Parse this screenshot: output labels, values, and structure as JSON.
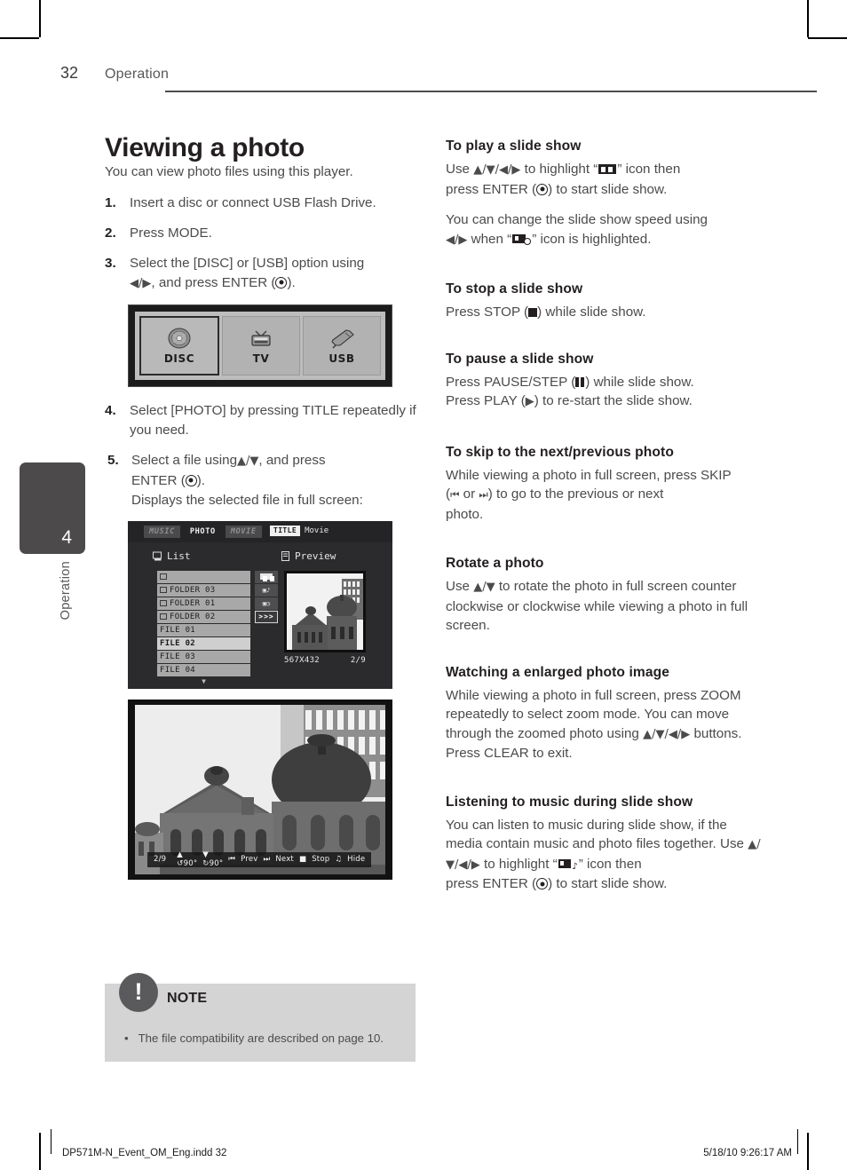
{
  "header": {
    "page_number": "32",
    "section": "Operation"
  },
  "side_tab": {
    "number": "4",
    "label": "Operation"
  },
  "left_column": {
    "title": "Viewing a photo",
    "intro": "You can view photo files using this player.",
    "steps": [
      {
        "num": "1.",
        "text": "Insert a disc or connect USB Flash Drive."
      },
      {
        "num": "2.",
        "text": "Press MODE."
      },
      {
        "num": "3.",
        "text": "Select the [DISC] or [USB] option using"
      },
      {
        "num": "4.",
        "text": "Select [PHOTO] by pressing TITLE repeatedly if you need."
      },
      {
        "num": "5.",
        "text": "Select a file using"
      }
    ],
    "step3_line2_prefix": "",
    "step3_line2_suffix": ", and press ENTER (",
    "step3_line2_end": ").",
    "step5_line1_suffix": ", and press",
    "step5_line2": "ENTER (",
    "step5_line2_end": ").",
    "step5_line3": "Displays the selected file in full screen:"
  },
  "source_screenshot": {
    "options": [
      {
        "label": "DISC",
        "icon": "disc-icon",
        "active": true
      },
      {
        "label": "TV",
        "icon": "tv-icon",
        "active": false
      },
      {
        "label": "USB",
        "icon": "usb-icon",
        "active": false
      }
    ]
  },
  "list_screenshot": {
    "tabs": [
      {
        "label": "MUSIC",
        "active": false
      },
      {
        "label": "PHOTO",
        "active": true
      },
      {
        "label": "MOVIE",
        "active": false
      }
    ],
    "title_badge": "TITLE",
    "title_text": "Movie",
    "list_header": "List",
    "preview_header": "Preview",
    "rows": [
      {
        "label": "",
        "type": "up",
        "selected": false
      },
      {
        "label": "FOLDER 03",
        "type": "folder",
        "selected": false
      },
      {
        "label": "FOLDER 01",
        "type": "folder",
        "selected": false
      },
      {
        "label": "FOLDER 02",
        "type": "folder",
        "selected": false
      },
      {
        "label": "FILE 01",
        "type": "file",
        "selected": false
      },
      {
        "label": "FILE 02",
        "type": "file",
        "selected": true
      },
      {
        "label": "FILE 03",
        "type": "file",
        "selected": false
      },
      {
        "label": "FILE 04",
        "type": "file",
        "selected": false
      }
    ],
    "scroll_indicator": "▼",
    "side_buttons": [
      {
        "name": "slideshow-icon",
        "label": "▬",
        "highlighted": false
      },
      {
        "name": "slideshow-music-icon",
        "label": "▬♪",
        "highlighted": false
      },
      {
        "name": "slideshow-speed-icon",
        "label": "▬◷",
        "highlighted": false
      },
      {
        "name": "fast-forward-icon",
        "label": ">>>",
        "highlighted": true
      }
    ],
    "resolution": "567X432",
    "index": "2/9"
  },
  "photo_screenshot": {
    "osd": {
      "index": "2/9",
      "rotate_ccw": "▲ ↺90°",
      "rotate_cw": "▼ ↻90°",
      "prev": "Prev",
      "next": "Next",
      "stop": "Stop",
      "hide": "Hide"
    }
  },
  "note": {
    "title": "NOTE",
    "bullet": "•",
    "text": "The file compatibility are described on page 10."
  },
  "right_column": {
    "sections": [
      {
        "heading": "To play a slide show",
        "paragraphs": [
          "Use ▲/▼/◀/▶ to highlight \" \" icon then press ENTER ( ) to start slide show.",
          "You can change the slide show speed using ◀/▶ when \" \" icon is highlighted."
        ]
      },
      {
        "heading": "To stop a slide show",
        "paragraphs": [
          "Press STOP ( ) while slide show."
        ]
      },
      {
        "heading": "To pause a slide show",
        "paragraphs": [
          "Press PAUSE/STEP ( ) while slide show.",
          "Press PLAY ( ) to re-start the slide show."
        ]
      },
      {
        "heading": "To skip to the next/previous photo",
        "paragraphs": [
          "While viewing a photo in full screen, press SKIP ( ◀◀ or ▶▶ ) to go to the previous or next photo."
        ]
      },
      {
        "heading": "Rotate a photo",
        "paragraphs": [
          "Use ▲/▼ to rotate the photo in full screen counter clockwise or clockwise while viewing a photo in full screen."
        ]
      },
      {
        "heading": "Watching a enlarged photo image",
        "paragraphs": [
          "While viewing a photo in full screen, press ZOOM repeatedly to select zoom mode. You can move through the zoomed photo using ▲/▼/◀/▶ buttons. Press CLEAR to exit."
        ]
      },
      {
        "heading": "Listening to music during slide show",
        "paragraphs": [
          "You can listen to music during slide show, if the media contain music and photo files together. Use ▲/▼/◀/▶ to highlight \" \" icon then press ENTER ( ) to start slide show."
        ]
      }
    ],
    "frag": {
      "play_use": "Use ",
      "play_arrows": "▲/▼/◀/▶",
      "play_hl": " to highlight “",
      "play_then": "” icon then",
      "play_press": "press ENTER (",
      "play_start": ") to start slide show.",
      "speed_1": "You can change the slide show speed using",
      "speed_arrows": "◀/▶",
      "speed_when": " when “",
      "speed_end": "” icon is highlighted.",
      "stop_1": "Press STOP (",
      "stop_2": ") while slide show.",
      "pause_1": "Press PAUSE/STEP (",
      "pause_2": ") while slide show.",
      "play2_1": "Press PLAY (",
      "play2_2": ") to re-start the slide show.",
      "skip_1": "While viewing a photo in full screen, press SKIP",
      "skip_2": "(",
      "skip_prev": "◀◀",
      "skip_or": " or ",
      "skip_next": "▶▶",
      "skip_3": ") to go to the previous or next",
      "skip_4": "photo.",
      "rotate_1": "Use ",
      "rotate_arrows": "▲/▼",
      "rotate_2": " to rotate the photo in full screen counter clockwise or clockwise while viewing a photo in full screen.",
      "zoom_1": "While viewing a photo in full screen, press ZOOM repeatedly to select zoom mode. You can move through the zoomed photo using ",
      "zoom_arrows": "▲/▼/◀/▶",
      "zoom_2": " buttons. Press CLEAR to exit.",
      "music_1": "You can listen to music during slide show, if the media contain music and photo files together. Use ",
      "music_arrows": "▲/▼/◀/▶",
      "music_2": " to highlight “",
      "music_3": "” icon then",
      "music_4": "press ENTER (",
      "music_5": ") to start slide show."
    }
  },
  "footer": {
    "file": "DP571M-N_Event_OM_Eng.indd   32",
    "timestamp": "5/18/10   9:26:17 AM"
  }
}
